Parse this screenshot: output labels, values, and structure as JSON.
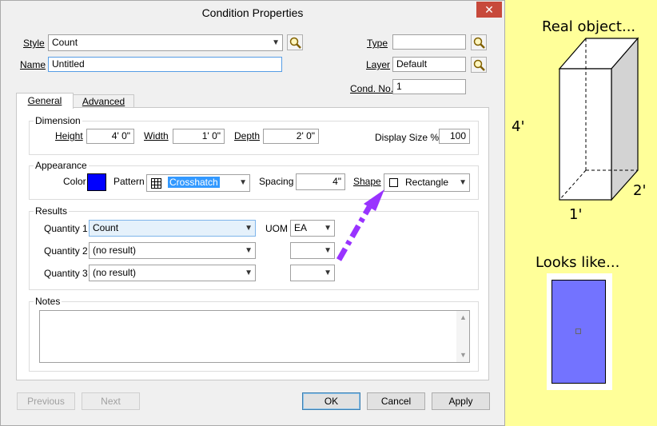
{
  "dialog": {
    "title": "Condition Properties",
    "close_label": "✕",
    "style": {
      "label": "Style",
      "value": "Count"
    },
    "name": {
      "label": "Name",
      "value": "Untitled"
    },
    "type": {
      "label": "Type",
      "value": ""
    },
    "layer": {
      "label": "Layer",
      "value": "Default"
    },
    "cond_no": {
      "label": "Cond. No.",
      "value": "1"
    },
    "tabs": [
      {
        "label": "General"
      },
      {
        "label": "Advanced"
      }
    ],
    "dimension": {
      "group_label": "Dimension",
      "height": {
        "label": "Height",
        "value": "4' 0\""
      },
      "width": {
        "label": "Width",
        "value": "1' 0\""
      },
      "depth": {
        "label": "Depth",
        "value": "2' 0\""
      },
      "display_size": {
        "label": "Display Size %",
        "value": "100"
      }
    },
    "appearance": {
      "group_label": "Appearance",
      "color_label": "Color",
      "color_value": "#0000ff",
      "pattern_label": "Pattern",
      "pattern_value": "Crosshatch",
      "spacing_label": "Spacing",
      "spacing_value": "4\"",
      "shape_label": "Shape",
      "shape_value": "Rectangle"
    },
    "results": {
      "group_label": "Results",
      "uom_label": "UOM",
      "quantities": [
        {
          "label": "Quantity 1",
          "value": "Count",
          "uom": "EA"
        },
        {
          "label": "Quantity 2",
          "value": "(no result)",
          "uom": ""
        },
        {
          "label": "Quantity 3",
          "value": "(no result)",
          "uom": ""
        }
      ]
    },
    "notes": {
      "group_label": "Notes",
      "value": ""
    },
    "buttons": {
      "previous": "Previous",
      "next": "Next",
      "ok": "OK",
      "cancel": "Cancel",
      "apply": "Apply"
    }
  },
  "annotation": {
    "real_object_title": "Real object...",
    "dim_height": "4'",
    "dim_width": "1'",
    "dim_depth": "2'",
    "looks_like_title": "Looks like...",
    "preview_color": "#7373ff",
    "arrow_color": "#9933ff",
    "background_color": "#ffff99"
  }
}
